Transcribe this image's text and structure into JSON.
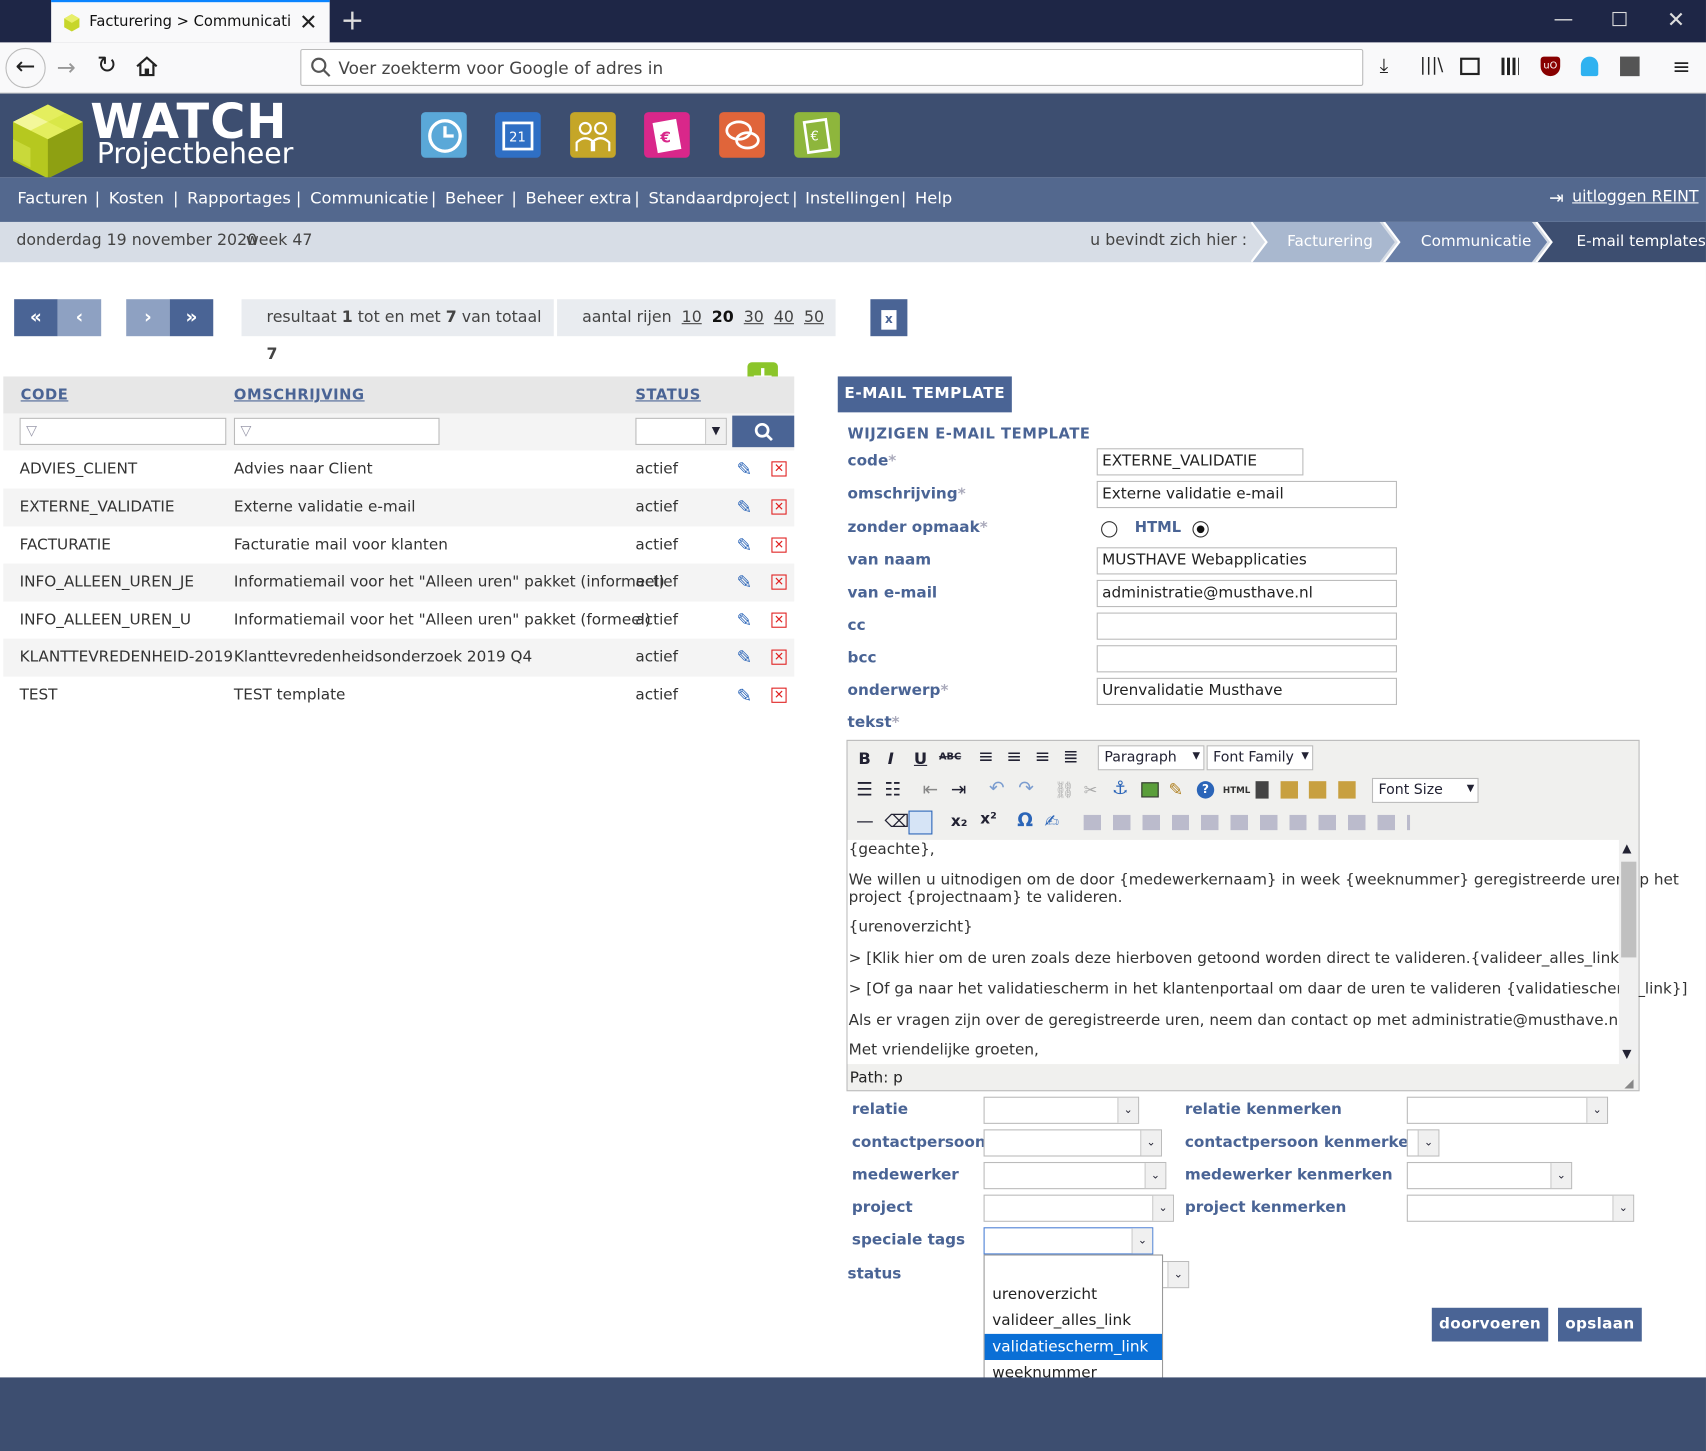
{
  "browser": {
    "tab_title": "Facturering > Communicatie > ",
    "url_placeholder": "Voer zoekterm voor Google of adres in"
  },
  "logo": {
    "line1": "WATCH",
    "line2": "Projectbeheer"
  },
  "menu": {
    "items": [
      "Facturen",
      "Kosten",
      "Rapportages",
      "Communicatie",
      "Beheer",
      "Beheer extra",
      "Standaardproject",
      "Instellingen",
      "Help"
    ],
    "logout": "uitloggen REINT"
  },
  "breadcrumb": {
    "date": "donderdag 19 november 2020",
    "week": "week 47",
    "here_label": "u bevindt zich hier :",
    "items": [
      "Facturering",
      "Communicatie",
      "E-mail templates"
    ]
  },
  "pager": {
    "first": "«",
    "prev": "‹",
    "next": "›",
    "last": "»",
    "result_prefix": "resultaat",
    "from": "1",
    "mid": "tot en met",
    "to": "7",
    "total_label": "van totaal",
    "total": "7",
    "rows_label": "aantal rijen",
    "row_options": [
      "10",
      "20",
      "30",
      "40",
      "50"
    ],
    "rows_selected": "20"
  },
  "table": {
    "headers": {
      "code": "CODE",
      "description": "OMSCHRIJVING",
      "status": "STATUS"
    },
    "rows": [
      {
        "code": "ADVIES_CLIENT",
        "description": "Advies naar Client",
        "status": "actief"
      },
      {
        "code": "EXTERNE_VALIDATIE",
        "description": "Externe validatie e-mail",
        "status": "actief"
      },
      {
        "code": "FACTURATIE",
        "description": "Facturatie mail voor klanten",
        "status": "actief"
      },
      {
        "code": "INFO_ALLEEN_UREN_JE",
        "description": "Informatiemail voor het \"Alleen uren\" pakket (informeel)",
        "status": "actief"
      },
      {
        "code": "INFO_ALLEEN_UREN_U",
        "description": "Informatiemail voor het \"Alleen uren\" pakket (formeel)",
        "status": "actief"
      },
      {
        "code": "KLANTTEVREDENHEID-2019",
        "description": "Klanttevredenheidsonderzoek 2019 Q4",
        "status": "actief"
      },
      {
        "code": "TEST",
        "description": "TEST template",
        "status": "actief"
      }
    ]
  },
  "form": {
    "panel_title": "E-MAIL TEMPLATE",
    "subtitle": "WIJZIGEN E-MAIL TEMPLATE",
    "labels": {
      "code": "code",
      "omschrijving": "omschrijving",
      "zonder_opmaak": "zonder opmaak",
      "html": "HTML",
      "van_naam": "van naam",
      "van_email": "van e-mail",
      "cc": "cc",
      "bcc": "bcc",
      "onderwerp": "onderwerp",
      "tekst": "tekst"
    },
    "required_mark": "*",
    "values": {
      "code": "EXTERNE_VALIDATIE",
      "omschrijving": "Externe validatie e-mail",
      "van_naam": "MUSTHAVE Webapplicaties",
      "van_email": "administratie@musthave.nl",
      "cc": "",
      "bcc": "",
      "onderwerp": "Urenvalidatie Musthave"
    },
    "format_selected": "HTML"
  },
  "editor": {
    "paragraph": "Paragraph",
    "font_family": "Font Family",
    "font_size": "Font Size",
    "lines": [
      "{geachte},",
      "We willen u uitnodigen om de door {medewerkernaam} in week {weeknummer} geregistreerde uren op het",
      "project {projectnaam} te valideren.",
      "{urenoverzicht}",
      "> [Klik hier om de uren zoals deze hierboven getoond worden direct te valideren.{valideer_alles_link}]",
      "> [Of ga naar het validatiescherm in het klantenportaal om daar de uren te valideren {validatiescherm_link}]",
      "Als er vragen zijn over de geregistreerde uren, neem dan contact op met administratie@musthave.nl",
      "Met vriendelijke groeten,"
    ],
    "path": "Path: p"
  },
  "tags": {
    "relatie": "relatie",
    "relatie_kenmerken": "relatie kenmerken",
    "contactpersoon": "contactpersoon",
    "contactpersoon_kenmerken": "contactpersoon kenmerken",
    "medewerker": "medewerker",
    "medewerker_kenmerken": "medewerker kenmerken",
    "project": "project",
    "project_kenmerken": "project kenmerken",
    "speciale_tags": "speciale tags",
    "status": "status"
  },
  "dropdown": {
    "options": [
      "",
      "urenoverzicht",
      "valideer_alles_link",
      "validatiescherm_link",
      "weeknummer"
    ],
    "highlighted": "validatiescherm_link"
  },
  "buttons": {
    "apply": "doorvoeren",
    "save": "opslaan"
  },
  "colors": {
    "header": "#3d4e70",
    "menu": "#53688e",
    "accent": "#4a6495",
    "highlight": "#0a6fd6",
    "add": "#8bc52a",
    "delete": "#e02020"
  }
}
